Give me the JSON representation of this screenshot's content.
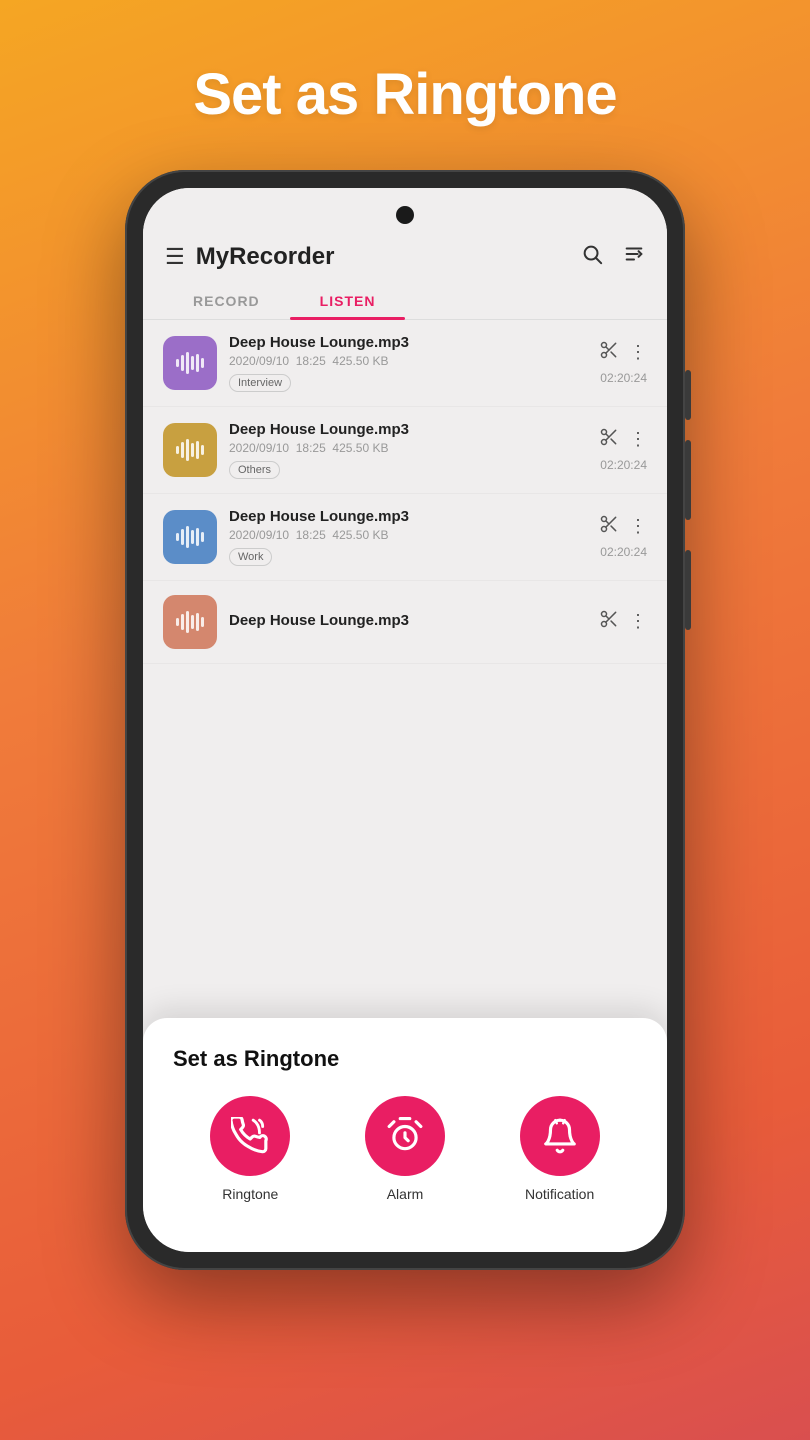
{
  "header": {
    "title": "Set as Ringtone",
    "app_name": "MyRecorder"
  },
  "tabs": [
    {
      "id": "record",
      "label": "RECORD",
      "active": false
    },
    {
      "id": "listen",
      "label": "LISTEN",
      "active": true
    }
  ],
  "recordings": [
    {
      "id": 1,
      "name": "Deep House Lounge.mp3",
      "date": "2020/09/10",
      "time": "18:25",
      "size": "425.50 KB",
      "duration": "02:20:24",
      "tag": "Interview",
      "thumb_color": "purple"
    },
    {
      "id": 2,
      "name": "Deep House Lounge.mp3",
      "date": "2020/09/10",
      "time": "18:25",
      "size": "425.50 KB",
      "duration": "02:20:24",
      "tag": "Others",
      "thumb_color": "gold"
    },
    {
      "id": 3,
      "name": "Deep House Lounge.mp3",
      "date": "2020/09/10",
      "time": "18:25",
      "size": "425.50 KB",
      "duration": "02:20:24",
      "tag": "Work",
      "thumb_color": "blue"
    },
    {
      "id": 4,
      "name": "Deep House Lounge.mp3",
      "date": "",
      "time": "",
      "size": "",
      "duration": "",
      "tag": "",
      "thumb_color": "salmon"
    }
  ],
  "bottom_sheet": {
    "title": "Set as Ringtone",
    "options": [
      {
        "id": "ringtone",
        "label": "Ringtone",
        "icon": "phone"
      },
      {
        "id": "alarm",
        "label": "Alarm",
        "icon": "alarm"
      },
      {
        "id": "notification",
        "label": "Notification",
        "icon": "bell"
      }
    ]
  },
  "icons": {
    "menu": "☰",
    "search": "🔍",
    "filter": "⇅",
    "scissors": "✂",
    "more": "⋮"
  }
}
